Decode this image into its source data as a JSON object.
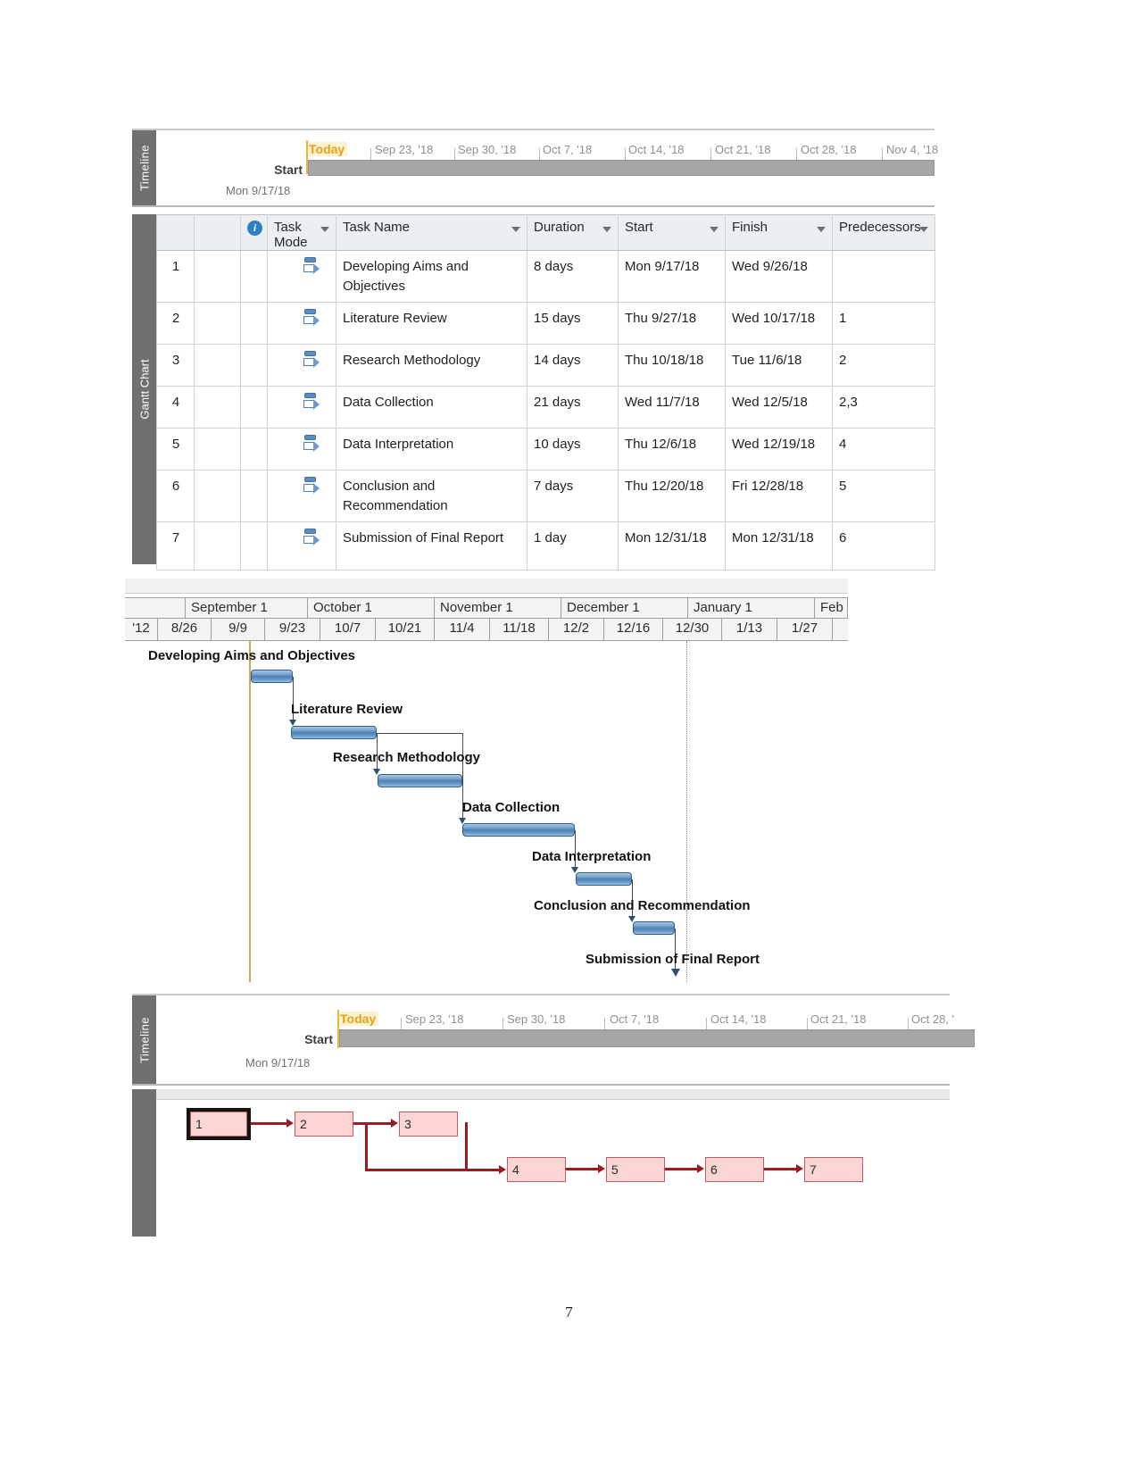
{
  "timeline_top": {
    "pane_label": "Timeline",
    "today_label": "Today",
    "start_label": "Start",
    "start_date": "Mon 9/17/18",
    "ticks": [
      "Sep 23, '18",
      "Sep 30, '18",
      "Oct 7, '18",
      "Oct 14, '18",
      "Oct 21, '18",
      "Oct 28, '18",
      "Nov 4, '18"
    ]
  },
  "sheet": {
    "pane_label": "Gantt Chart",
    "columns": [
      {
        "key": "rownum",
        "label": ""
      },
      {
        "key": "indicator",
        "label": ""
      },
      {
        "key": "info",
        "label": "info-icon"
      },
      {
        "key": "task_mode",
        "label": "Task Mode"
      },
      {
        "key": "task_name",
        "label": "Task Name"
      },
      {
        "key": "duration",
        "label": "Duration"
      },
      {
        "key": "start",
        "label": "Start"
      },
      {
        "key": "finish",
        "label": "Finish"
      },
      {
        "key": "predecessors",
        "label": "Predecessors"
      }
    ],
    "highlighted_column": "Finish",
    "rows": [
      {
        "id": "1",
        "task_name": "Developing Aims and Objectives",
        "duration": "8 days",
        "start": "Mon 9/17/18",
        "finish": "Wed 9/26/18",
        "predecessors": ""
      },
      {
        "id": "2",
        "task_name": "Literature Review",
        "duration": "15 days",
        "start": "Thu 9/27/18",
        "finish": "Wed 10/17/18",
        "predecessors": "1"
      },
      {
        "id": "3",
        "task_name": "Research Methodology",
        "duration": "14 days",
        "start": "Thu 10/18/18",
        "finish": "Tue 11/6/18",
        "predecessors": "2"
      },
      {
        "id": "4",
        "task_name": "Data Collection",
        "duration": "21 days",
        "start": "Wed 11/7/18",
        "finish": "Wed 12/5/18",
        "predecessors": "2,3"
      },
      {
        "id": "5",
        "task_name": "Data Interpretation",
        "duration": "10 days",
        "start": "Thu 12/6/18",
        "finish": "Wed 12/19/18",
        "predecessors": "4"
      },
      {
        "id": "6",
        "task_name": "Conclusion and Recommendation",
        "duration": "7 days",
        "start": "Thu 12/20/18",
        "finish": "Fri 12/28/18",
        "predecessors": "5"
      },
      {
        "id": "7",
        "task_name": "Submission of Final Report",
        "duration": "1 day",
        "start": "Mon 12/31/18",
        "finish": "Mon 12/31/18",
        "predecessors": "6"
      }
    ]
  },
  "chart_data": {
    "type": "bar",
    "title": "Gantt Chart",
    "xlabel": "",
    "ylabel": "",
    "grid": true,
    "legend": "none",
    "months": [
      "September 1",
      "October 1",
      "November 1",
      "December 1",
      "January 1",
      "Feb"
    ],
    "weeks": [
      "'12",
      "8/26",
      "9/9",
      "9/23",
      "10/7",
      "10/21",
      "11/4",
      "11/18",
      "12/2",
      "12/16",
      "12/30",
      "1/13",
      "1/27"
    ],
    "categories": [
      "Developing Aims and Objectives",
      "Literature Review",
      "Research Methodology",
      "Data Collection",
      "Data Interpretation",
      "Conclusion and Recommendation",
      "Submission of Final Report"
    ],
    "values": [
      8,
      15,
      14,
      21,
      10,
      7,
      1
    ],
    "bars": [
      {
        "label": "Developing Aims and Objectives",
        "start": "Mon 9/17/18",
        "finish": "Wed 9/26/18",
        "duration_days": 8,
        "milestone": false
      },
      {
        "label": "Literature Review",
        "start": "Thu 9/27/18",
        "finish": "Wed 10/17/18",
        "duration_days": 15,
        "milestone": false
      },
      {
        "label": "Research Methodology",
        "start": "Thu 10/18/18",
        "finish": "Tue 11/6/18",
        "duration_days": 14,
        "milestone": false
      },
      {
        "label": "Data Collection",
        "start": "Wed 11/7/18",
        "finish": "Wed 12/5/18",
        "duration_days": 21,
        "milestone": false
      },
      {
        "label": "Data Interpretation",
        "start": "Thu 12/6/18",
        "finish": "Wed 12/19/18",
        "duration_days": 10,
        "milestone": false
      },
      {
        "label": "Conclusion and Recommendation",
        "start": "Thu 12/20/18",
        "finish": "Fri 12/28/18",
        "duration_days": 7,
        "milestone": false
      },
      {
        "label": "Submission of Final Report",
        "start": "Mon 12/31/18",
        "finish": "Mon 12/31/18",
        "duration_days": 1,
        "milestone": true
      }
    ],
    "bar_color": "#5b8fc4",
    "today_line_color": "#c6a75b"
  },
  "timeline_bottom": {
    "pane_label": "Timeline",
    "today_label": "Today",
    "start_label": "Start",
    "start_date": "Mon 9/17/18",
    "ticks": [
      "Sep 23, '18",
      "Sep 30, '18",
      "Oct 7, '18",
      "Oct 14, '18",
      "Oct 21, '18",
      "Oct 28, '"
    ]
  },
  "network_diagram": {
    "nodes": [
      "1",
      "2",
      "3",
      "4",
      "5",
      "6",
      "7"
    ],
    "edges": [
      {
        "from": "1",
        "to": "2"
      },
      {
        "from": "2",
        "to": "3"
      },
      {
        "from": "2",
        "to": "4"
      },
      {
        "from": "3",
        "to": "4"
      },
      {
        "from": "4",
        "to": "5"
      },
      {
        "from": "5",
        "to": "6"
      },
      {
        "from": "6",
        "to": "7"
      }
    ],
    "node_fill": "#fbd4d4",
    "edge_color": "#9b1b25"
  },
  "page": {
    "number": "7"
  }
}
